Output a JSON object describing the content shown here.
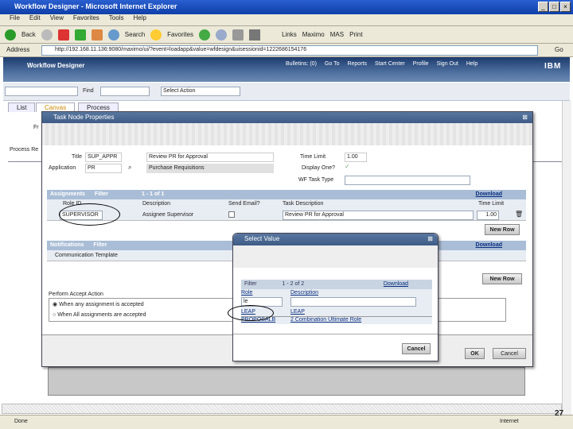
{
  "window": {
    "title": "Workflow Designer - Microsoft Internet Explorer"
  },
  "menu": [
    "File",
    "Edit",
    "View",
    "Favorites",
    "Tools",
    "Help"
  ],
  "toolbar": {
    "back": "Back",
    "search": "Search",
    "favorites": "Favorites",
    "links": "Links",
    "link1": "Maximo",
    "link2": "MAS",
    "link3": "Print"
  },
  "address": {
    "label": "Address",
    "url": "http://192.168.11.136:9080/maximo/ui/?event=loadapp&value=wfdesign&uisessionid=1222686154176",
    "go": "Go"
  },
  "app": {
    "title": "Workflow Designer",
    "nav": [
      "Bulletins: (0)",
      "Go To",
      "Reports",
      "Start Center",
      "Profile",
      "Sign Out",
      "Help"
    ],
    "logo": "IBM"
  },
  "apptoolbar": {
    "find": "Find",
    "select_action": "Select Action"
  },
  "tabs": [
    "List",
    "Canvas",
    "Process"
  ],
  "bg": {
    "process_label": "Process Re",
    "f_label": "Fr"
  },
  "task": {
    "title": "Task Node Properties",
    "title_label": "Title",
    "title_value": "SUP_APPR",
    "title_desc": "Review PR for Approval",
    "app_label": "Application",
    "app_value": "PR",
    "app_desc": "Purchase Requisitions",
    "time_limit_label": "Time Limit",
    "time_limit_value": "1.00",
    "display_one_label": "Display One?",
    "wf_task_type_label": "WF Task Type",
    "assignments": {
      "header": "Assignments",
      "filter": "Filter",
      "paging": "1 - 1 of 1",
      "download": "Download",
      "columns": [
        "Role ID",
        "Description",
        "Send Email?",
        "Task Description",
        "Time Limit"
      ],
      "rows": [
        {
          "role": "SUPERVISOR",
          "desc": "Assignee Supervisor",
          "task": "Review PR for Approval",
          "time": "1.00"
        }
      ]
    },
    "new_row": "New Row",
    "notifications": {
      "header": "Notifications",
      "filter": "Filter",
      "download": "Download",
      "column": "Communication Template"
    },
    "accept_label": "Perform Accept Action",
    "accept_opt1": "When any assignment is accepted",
    "accept_opt2": "When All assignments are accepted",
    "ok": "OK",
    "cancel": "Cancel"
  },
  "select": {
    "title": "Select Value",
    "filter": "Filter",
    "paging": "1 - 2 of 2",
    "download": "Download",
    "columns": [
      "Role",
      "Description"
    ],
    "filter_value": "le",
    "rows": [
      {
        "role": "LEAP",
        "desc": "LEAP"
      },
      {
        "role": "PROPOSALB",
        "desc": "2 Combination Ultimate Role"
      }
    ],
    "cancel": "Cancel"
  },
  "status": {
    "text": "Done",
    "zone": "Internet"
  },
  "page_number": "27"
}
